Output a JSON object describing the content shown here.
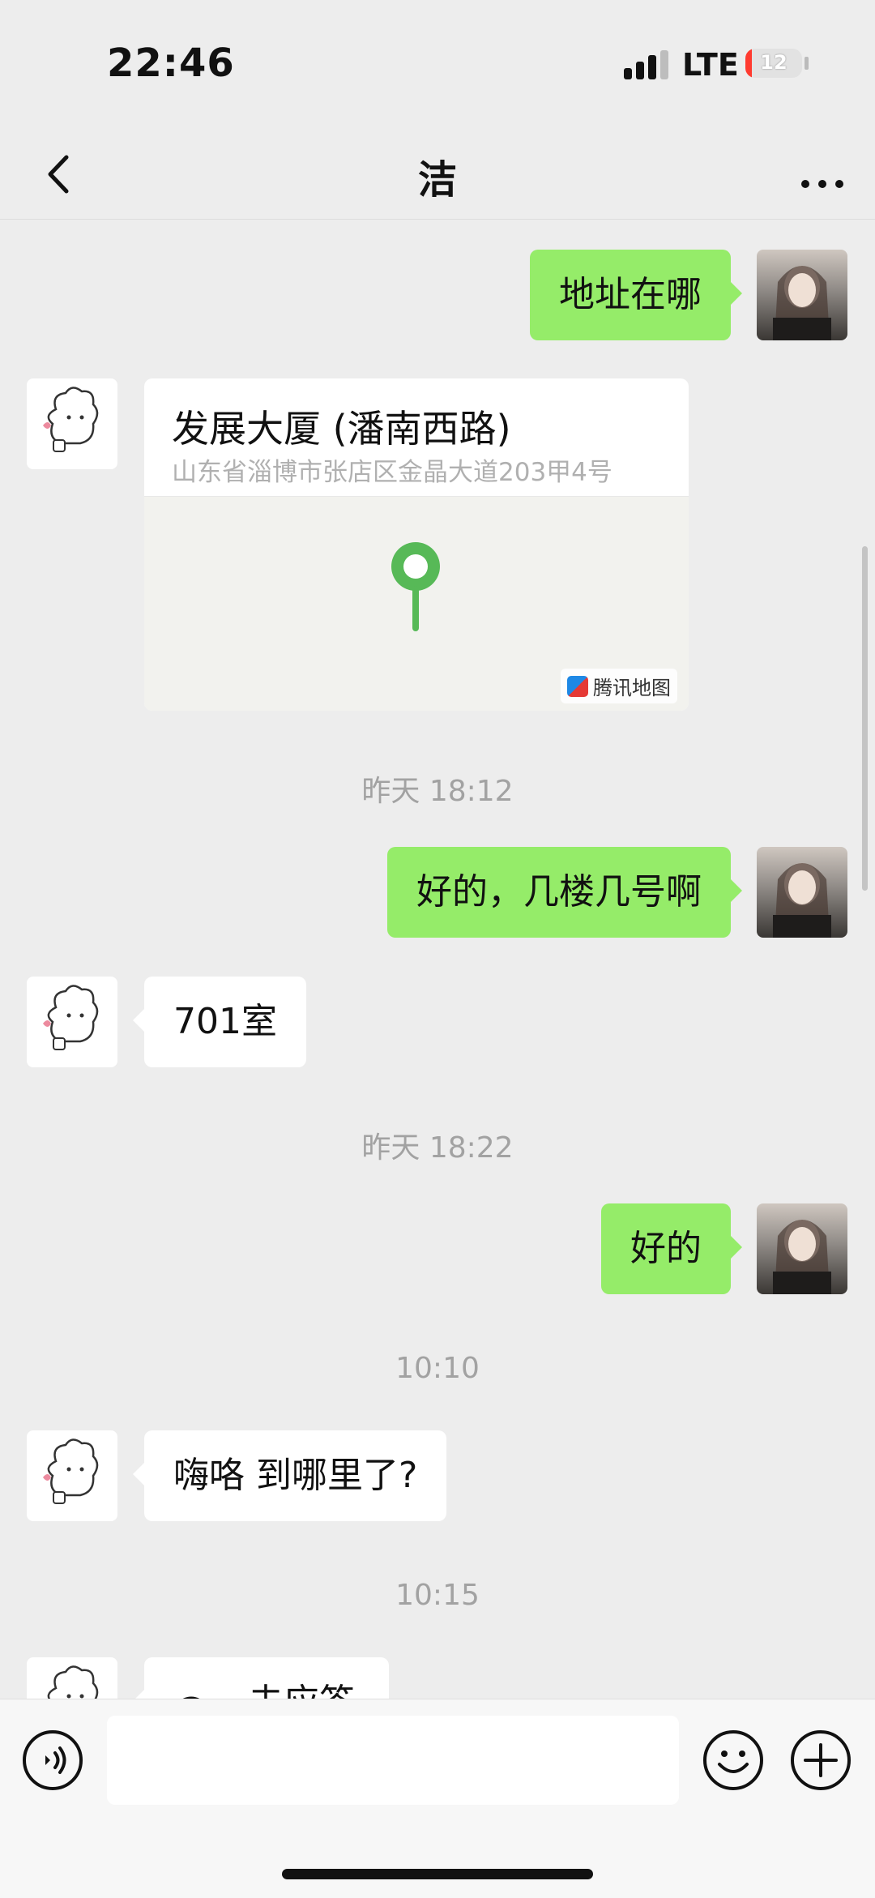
{
  "status_bar": {
    "time": "22:46",
    "network": "LTE",
    "battery": "12",
    "battery_level_percent": 12
  },
  "nav": {
    "title": "洁"
  },
  "messages": {
    "m1": "地址在哪",
    "location": {
      "title": "发展大厦 (潘南西路)",
      "address": "山东省淄博市张店区金晶大道203甲4号",
      "map_brand": "腾讯地图"
    },
    "t1": "昨天 18:12",
    "m2": "好的，几楼几号啊",
    "m3": "701室",
    "t2": "昨天 18:22",
    "m4": "好的",
    "t3": "10:10",
    "m5": "嗨咯 到哪里了?",
    "t4": "10:15",
    "m6": "未应答"
  },
  "input": {
    "placeholder": ""
  },
  "colors": {
    "self_bubble": "#95ec69",
    "other_bubble": "#ffffff",
    "background": "#ededed"
  },
  "icons": {
    "back": "chevron-left-icon",
    "more": "more-dots-icon",
    "voice": "voice-icon",
    "emoji": "emoji-icon",
    "plus": "plus-icon",
    "pin": "location-pin-icon"
  }
}
